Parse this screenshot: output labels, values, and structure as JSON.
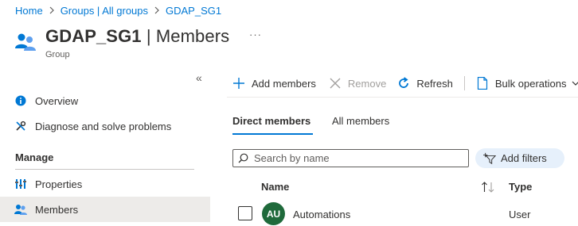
{
  "breadcrumb": {
    "items": [
      "Home",
      "Groups | All groups",
      "GDAP_SG1"
    ]
  },
  "header": {
    "title_strong": "GDAP_SG1",
    "title_rest": " | Members",
    "subtitle": "Group",
    "more_label": "···"
  },
  "sidebar": {
    "collapse_label": "«",
    "items": [
      {
        "label": "Overview",
        "icon": "info-icon"
      },
      {
        "label": "Diagnose and solve problems",
        "icon": "wrench-icon"
      }
    ],
    "section_label": "Manage",
    "manage_items": [
      {
        "label": "Properties",
        "icon": "properties-icon"
      },
      {
        "label": "Members",
        "icon": "members-icon",
        "selected": true
      }
    ]
  },
  "toolbar": {
    "add_members": "Add members",
    "remove": "Remove",
    "refresh": "Refresh",
    "bulk_operations": "Bulk operations"
  },
  "tabs": {
    "direct": "Direct members",
    "all": "All members",
    "active": "direct"
  },
  "search": {
    "placeholder": "Search by name",
    "value": ""
  },
  "filter": {
    "label": "Add filters"
  },
  "table": {
    "columns": [
      "Name",
      "Type"
    ],
    "sort": "ascending",
    "rows": [
      {
        "initials": "AU",
        "name": "Automations",
        "type": "User",
        "avatar_color": "#1f6a3b"
      }
    ]
  },
  "colors": {
    "accent": "#0078d4",
    "selected_bg": "#edebe9",
    "filter_bg": "#e6f0fb",
    "avatar_green": "#1f6a3b"
  }
}
